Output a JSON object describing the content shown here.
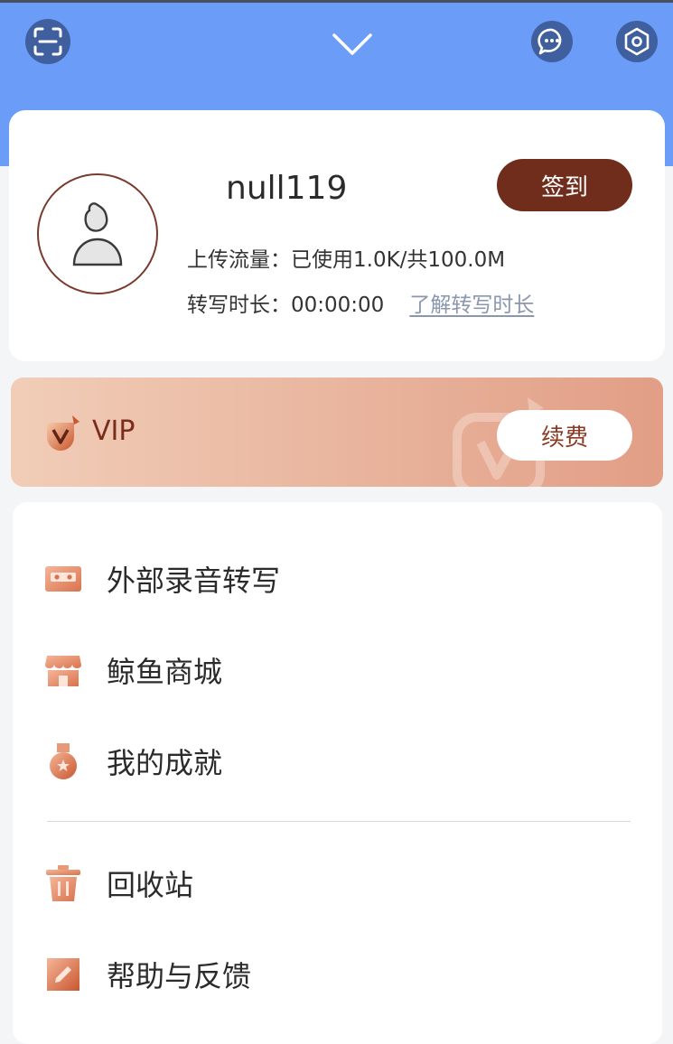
{
  "topbar": {
    "bg_color": "#6a9cf8",
    "icons": [
      "scan-icon",
      "chevron-down-icon",
      "message-icon",
      "settings-icon"
    ]
  },
  "profile": {
    "username": "null119",
    "checkin_label": "签到",
    "upload_line": "上传流量：已使用1.0K/共100.0M",
    "transcribe_line": "转写时长：00:00:00",
    "learn_link": "了解转写时长",
    "accent_color": "#702d1c"
  },
  "vip": {
    "label": "VIP",
    "renew_label": "续费"
  },
  "menu": {
    "items": [
      {
        "label": "外部录音转写",
        "icon": "cassette-icon"
      },
      {
        "label": "鲸鱼商城",
        "icon": "shop-icon"
      },
      {
        "label": "我的成就",
        "icon": "medal-icon"
      },
      {
        "label": "回收站",
        "icon": "trash-icon"
      },
      {
        "label": "帮助与反馈",
        "icon": "edit-icon"
      }
    ]
  }
}
